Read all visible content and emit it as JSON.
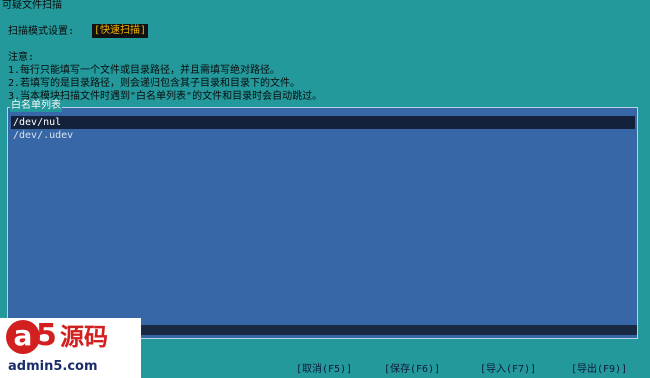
{
  "window": {
    "title": "可疑文件扫描"
  },
  "scan_mode": {
    "label": "扫描模式设置:",
    "value": "[快速扫描]"
  },
  "notes": {
    "title": "注意:",
    "items": [
      "1.每行只能填写一个文件或目录路径，并且需填写绝对路径。",
      "2.若填写的是目录路径，则会递归包含其子目录和目录下的文件。",
      "3.当本模块扫描文件时遇到\"白名单列表\"的文件和目录时会自动跳过。"
    ]
  },
  "whitelist": {
    "title": "白名单列表",
    "entries": [
      "/dev/nul",
      "/dev/.udev"
    ],
    "selected_index": 0
  },
  "buttons": {
    "cancel": "[取消(F5)]",
    "save": "[保存(F6)]",
    "import": "[导入(F7)]",
    "export": "[导出(F9)]"
  },
  "watermark": {
    "mark_a": "a",
    "mark_5": "5",
    "text": "源码",
    "url": "admin5.com"
  },
  "colors": {
    "background": "#23999c",
    "list_bg": "#3867a8",
    "selected_bg": "#14213a",
    "mode_value": "#f2b400",
    "logo_red": "#d21f1f"
  }
}
